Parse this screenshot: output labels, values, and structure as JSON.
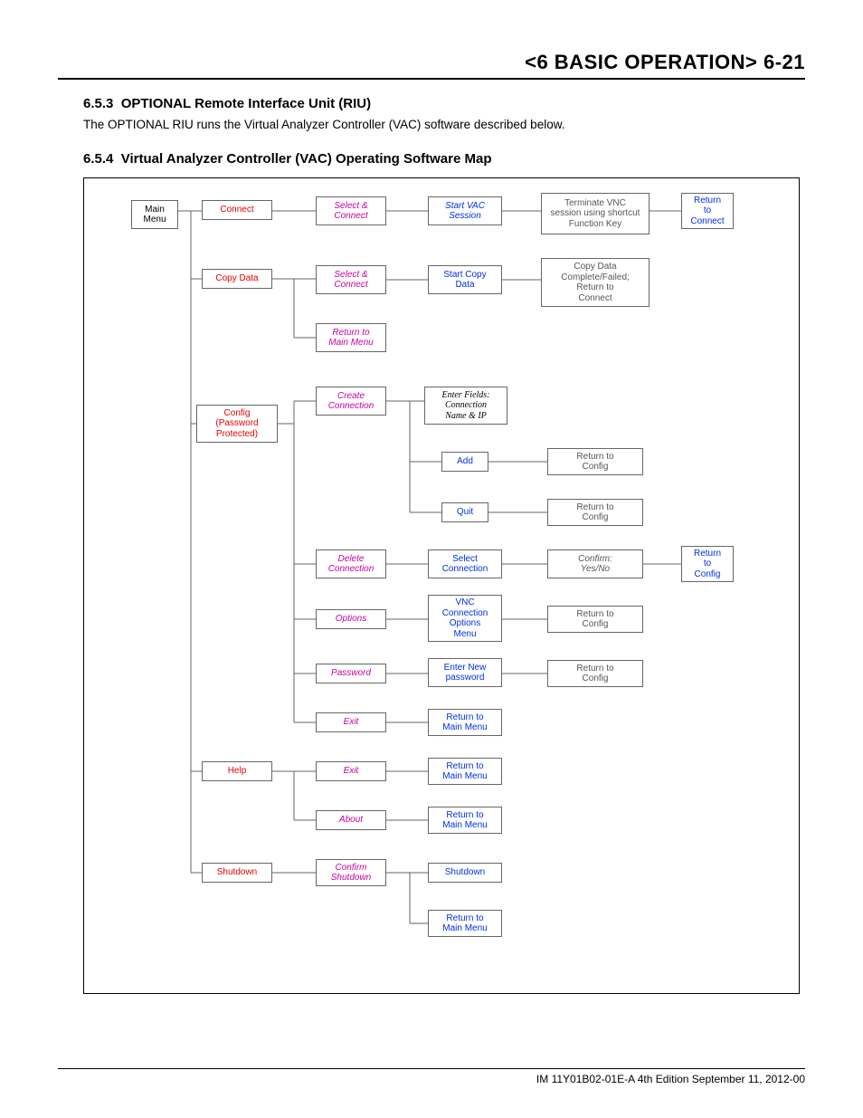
{
  "header": "<6 BASIC OPERATION>  6-21",
  "s1": {
    "num": "6.5.3",
    "title": "OPTIONAL Remote Interface Unit (RIU)"
  },
  "p1": "The OPTIONAL RIU runs the Virtual Analyzer Controller (VAC) software described below.",
  "s2": {
    "num": "6.5.4",
    "title": "Virtual Analyzer Controller (VAC)   Operating Software Map"
  },
  "footer": "IM 11Y01B02-01E-A  4th Edition September 11, 2012-00",
  "b": {
    "mainmenu": "Main\nMenu",
    "connect": "Connect",
    "sel_conn1": "Select &\nConnect",
    "start_vac": "Start VAC\nSession",
    "term_vnc": "Terminate VNC\nsession using shortcut\nFunction Key",
    "ret_conn1": "Return\nto\nConnect",
    "copydata": "Copy Data",
    "sel_conn2": "Select &\nConnect",
    "start_copy": "Start Copy\nData",
    "copy_result": "Copy Data\nComplete/Failed;\nReturn to\nConnect",
    "ret_main1": "Return to\nMain Menu",
    "config": "Config\n(Password\nProtected)",
    "create_conn": "Create\nConnection",
    "enter_fields": "Enter Fields:\nConnection\nName & IP",
    "add": "Add",
    "ret_cfg1": "Return to\nConfig",
    "quit": "Quit",
    "ret_cfg2": "Return to\nConfig",
    "del_conn": "Delete\nConnection",
    "sel_conn3": "Select\nConnection",
    "confirm_yn": "Confirm:\nYes/No",
    "ret_cfg3": "Return\nto\nConfig",
    "options": "Options",
    "vnc_menu": "VNC\nConnection\nOptions\nMenu",
    "ret_cfg4": "Return to\nConfig",
    "password": "Password",
    "enter_pw": "Enter New\npassword",
    "ret_cfg5": "Return to\nConfig",
    "exit1": "Exit",
    "ret_main2": "Return to\nMain Menu",
    "help": "Help",
    "exit2": "Exit",
    "ret_main3": "Return to\nMain Menu",
    "about": "About",
    "ret_main4": "Return to\nMain Menu",
    "shutdown": "Shutdown",
    "conf_shut": "Confirm\nShutdown",
    "shutdown2": "Shutdown",
    "ret_main5": "Return to\nMain Menu"
  }
}
